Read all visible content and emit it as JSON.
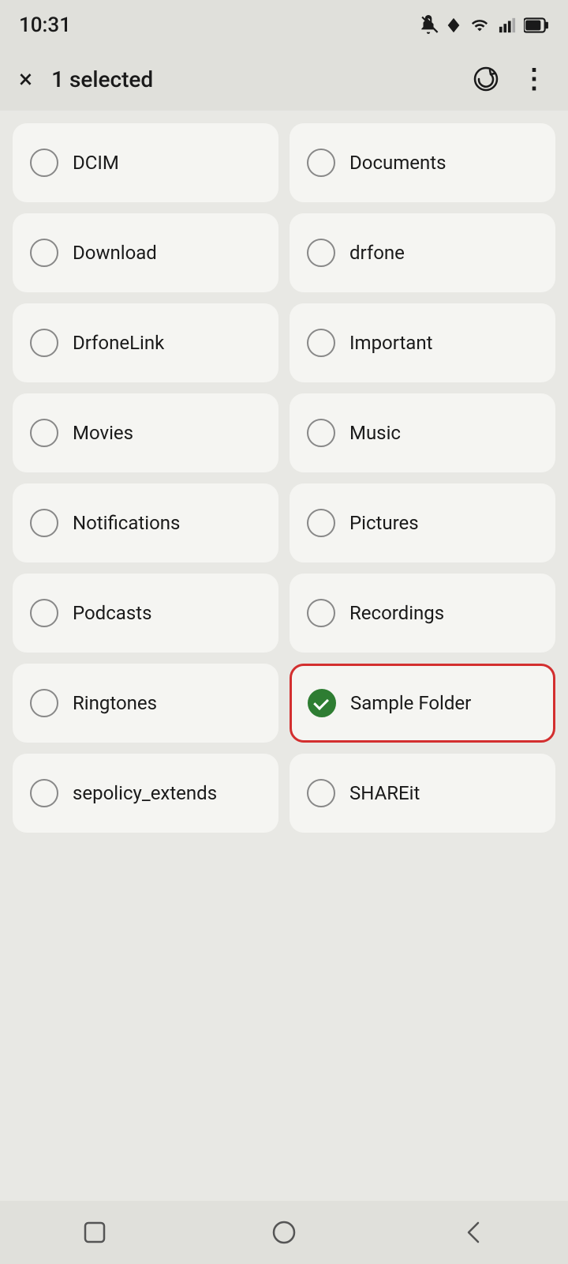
{
  "statusBar": {
    "time": "10:31",
    "icons": [
      "mute",
      "location",
      "wifi",
      "signal",
      "battery"
    ]
  },
  "actionBar": {
    "title": "1 selected",
    "closeLabel": "×",
    "syncLabel": "sync",
    "moreLabel": "⋮"
  },
  "folders": [
    {
      "id": "dcim",
      "name": "DCIM",
      "selected": false,
      "highlighted": false
    },
    {
      "id": "documents",
      "name": "Documents",
      "selected": false,
      "highlighted": false
    },
    {
      "id": "download",
      "name": "Download",
      "selected": false,
      "highlighted": false
    },
    {
      "id": "drfone",
      "name": "drfone",
      "selected": false,
      "highlighted": false
    },
    {
      "id": "drfonelink",
      "name": "DrfoneLink",
      "selected": false,
      "highlighted": false
    },
    {
      "id": "important",
      "name": "Important",
      "selected": false,
      "highlighted": false
    },
    {
      "id": "movies",
      "name": "Movies",
      "selected": false,
      "highlighted": false
    },
    {
      "id": "music",
      "name": "Music",
      "selected": false,
      "highlighted": false
    },
    {
      "id": "notifications",
      "name": "Notifications",
      "selected": false,
      "highlighted": false
    },
    {
      "id": "pictures",
      "name": "Pictures",
      "selected": false,
      "highlighted": false
    },
    {
      "id": "podcasts",
      "name": "Podcasts",
      "selected": false,
      "highlighted": false
    },
    {
      "id": "recordings",
      "name": "Recordings",
      "selected": false,
      "highlighted": false
    },
    {
      "id": "ringtones",
      "name": "Ringtones",
      "selected": false,
      "highlighted": false
    },
    {
      "id": "sample-folder",
      "name": "Sample Folder",
      "selected": true,
      "highlighted": true
    },
    {
      "id": "sepolicy",
      "name": "sepolicy_extends",
      "selected": false,
      "highlighted": false
    },
    {
      "id": "shareit",
      "name": "SHAREit",
      "selected": false,
      "highlighted": false
    }
  ],
  "bottomNav": {
    "square": "square",
    "circle": "circle",
    "back": "back"
  }
}
